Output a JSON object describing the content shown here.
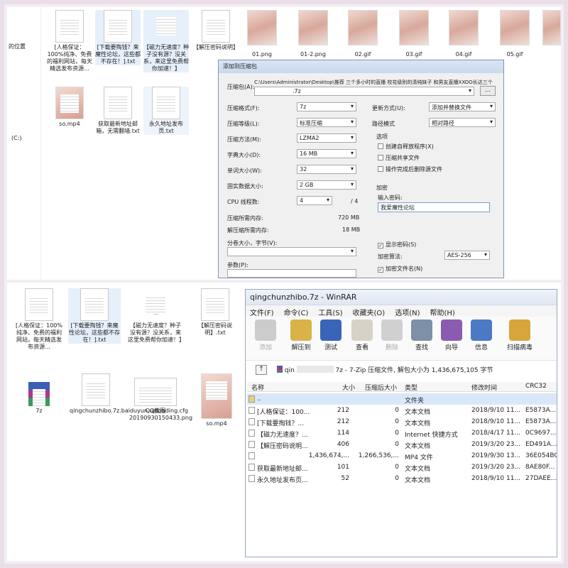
{
  "top": {
    "side_labels": [
      "的位置",
      "(C:)"
    ],
    "files": [
      {
        "label": "[人格保证：100%纯净、免费的福利网站，每天精选发布资源..."
      },
      {
        "label": "[下载要掏钱？来魔性论坛，这些都不存在！].txt"
      },
      {
        "label": "【磁力无速度？种子没有源？没关系，来这里免费帮你加速！】"
      },
      {
        "label": "【解压密码说明】"
      },
      {
        "label": "so.mp4"
      },
      {
        "label": "获取最新地址邮箱，无需翻墙.txt"
      },
      {
        "label": "永久地址发布页.txt"
      }
    ],
    "thumbs": [
      "01.png",
      "01-2.png",
      "02.gif",
      "03.gif",
      "04.gif",
      "05.gif"
    ]
  },
  "dialog": {
    "title": "添加到压缩包",
    "archive_name_label": "压缩包(A):",
    "archive_path": "C:\\Users\\Administrator\\Desktop\\推荐 三个多小时的直播 校花级别的清纯妹子 和男友直播XXOO长达三个",
    "archive_ext": ".7z",
    "browse": "...",
    "fields": [
      {
        "label": "压缩格式(F):",
        "value": "7z"
      },
      {
        "label": "压缩等级(L):",
        "value": "标准压缩"
      },
      {
        "label": "压缩方法(M):",
        "value": "LZMA2"
      },
      {
        "label": "字典大小(D):",
        "value": "16 MB"
      },
      {
        "label": "单词大小(W):",
        "value": "32"
      },
      {
        "label": "固实数据大小:",
        "value": "2 GB"
      }
    ],
    "cpu_label": "CPU 线程数:",
    "cpu_value": "4",
    "cpu_total": "/ 4",
    "mem_comp_label": "压缩所需内存:",
    "mem_comp": "720 MB",
    "mem_decomp_label": "解压缩所需内存:",
    "mem_decomp": "18 MB",
    "split_label": "分卷大小，字节(V):",
    "params_label": "参数(P):",
    "update_label": "更新方式(U):",
    "update_value": "添加并替换文件",
    "path_label": "路径模式",
    "path_value": "相对路径",
    "options_label": "选项",
    "options": [
      "创建自释放程序(X)",
      "压缩共享文件",
      "操作完成后删除源文件"
    ],
    "encrypt_label": "加密",
    "pwd_label": "输入密码:",
    "pwd_value": "我爱魔性论坛",
    "show_pwd": "显示密码(S)",
    "enc_method_label": "加密算法:",
    "enc_method": "AES-256",
    "enc_names": "加密文件名(N)"
  },
  "bottom": {
    "files": [
      {
        "label": "[人格保证：100%纯净、免费的福利网站，每天精选发布资源..."
      },
      {
        "label": "[下载要掏钱？来魔性论坛，这些都不存在！].txt"
      },
      {
        "label": "【磁力无速度？种子没有源？没关系，来这里免费帮你加速！】"
      },
      {
        "label": "【解压密码说明】.txt"
      },
      {
        "label": "7z"
      },
      {
        "label": "qingchunzhibo.7z.baiduyun.uploading.cfg"
      },
      {
        "label": "QQ截图20190930150433.png"
      },
      {
        "label": "so.mp4"
      }
    ]
  },
  "winrar": {
    "title": "qingchunzhibo.7z - WinRAR",
    "menu": [
      "文件(F)",
      "命令(C)",
      "工具(S)",
      "收藏夹(O)",
      "选项(N)",
      "帮助(H)"
    ],
    "tools": [
      "添加",
      "解压到",
      "测试",
      "查看",
      "删除",
      "查找",
      "向导",
      "信息",
      "扫描病毒"
    ],
    "path_prefix": "qin",
    "path_suffix": "7z - 7-Zip 压缩文件, 解包大小为 1,436,675,105 字节",
    "columns": [
      "名称",
      "大小",
      "压缩后大小",
      "类型",
      "修改时间",
      "CRC32"
    ],
    "rows": [
      {
        "name": "..",
        "size": "",
        "packed": "",
        "type": "文件夹",
        "time": "",
        "crc": ""
      },
      {
        "name": "[人格保证：100...",
        "size": "212",
        "packed": "0",
        "type": "文本文档",
        "time": "2018/9/10 11...",
        "crc": "E5873A..."
      },
      {
        "name": "[下载要掏钱？...",
        "size": "212",
        "packed": "0",
        "type": "文本文档",
        "time": "2018/9/10 11...",
        "crc": "E5873A..."
      },
      {
        "name": "【磁力无速度？...",
        "size": "114",
        "packed": "0",
        "type": "Internet 快捷方式",
        "time": "2018/4/17 11...",
        "crc": "0C9697..."
      },
      {
        "name": "【解压密码说明...",
        "size": "406",
        "packed": "0",
        "type": "文本文档",
        "time": "2019/3/20 23...",
        "crc": "ED491A..."
      },
      {
        "name": "",
        "size": "1,436,674,...",
        "packed": "1,266,536,...",
        "type": "MP4 文件",
        "time": "2019/9/30 13...",
        "crc": "36E054BC"
      },
      {
        "name": "获取最新地址邮...",
        "size": "101",
        "packed": "0",
        "type": "文本文档",
        "time": "2019/3/20 23...",
        "crc": "8AE80F..."
      },
      {
        "name": "永久地址发布页...",
        "size": "52",
        "packed": "0",
        "type": "文本文档",
        "time": "2018/9/10 11...",
        "crc": "27DAEE..."
      }
    ]
  }
}
